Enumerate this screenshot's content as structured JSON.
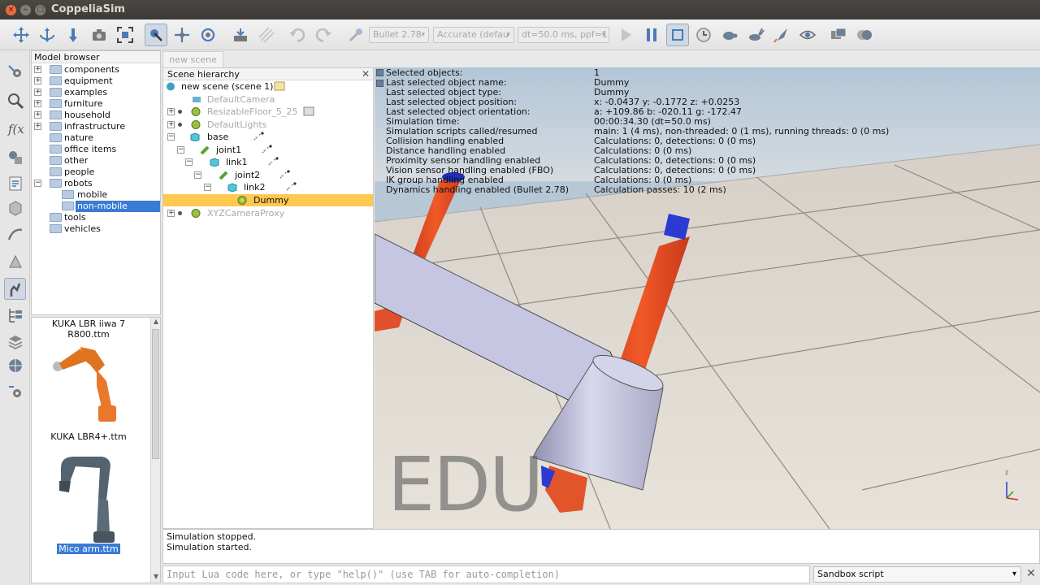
{
  "window": {
    "title": "CoppeliaSim",
    "close": "×",
    "minimize": "–",
    "maximize": "□"
  },
  "toolbar": {
    "physics_engine": "Bullet 2.78",
    "accuracy": "Accurate (defau",
    "time_step": "dt=50.0 ms, ppf=1"
  },
  "model_browser": {
    "title": "Model browser",
    "items": [
      {
        "label": "components",
        "expander": "+"
      },
      {
        "label": "equipment",
        "expander": "+"
      },
      {
        "label": "examples",
        "expander": "+"
      },
      {
        "label": "furniture",
        "expander": "+"
      },
      {
        "label": "household",
        "expander": "+"
      },
      {
        "label": "infrastructure",
        "expander": "+"
      },
      {
        "label": "nature",
        "expander": ""
      },
      {
        "label": "office items",
        "expander": ""
      },
      {
        "label": "other",
        "expander": ""
      },
      {
        "label": "people",
        "expander": ""
      },
      {
        "label": "robots",
        "expander": "−"
      },
      {
        "label": "mobile",
        "expander": ""
      },
      {
        "label": "non-mobile",
        "expander": ""
      },
      {
        "label": "tools",
        "expander": ""
      },
      {
        "label": "vehicles",
        "expander": ""
      }
    ]
  },
  "thumbnails": {
    "items": [
      {
        "caption": "KUKA LBR iiwa 7 R800.ttm"
      },
      {
        "caption": "KUKA LBR4+.ttm"
      },
      {
        "caption": "Mico arm.ttm"
      }
    ],
    "scroll_up": "▲",
    "scroll_down": "▼"
  },
  "scene_tab": {
    "label": "new scene"
  },
  "hierarchy": {
    "title": "Scene hierarchy",
    "close": "✕",
    "rows": [
      {
        "label": "new scene (scene 1)"
      },
      {
        "label": "DefaultCamera"
      },
      {
        "label": "ResizableFloor_5_25"
      },
      {
        "label": "DefaultLights"
      },
      {
        "label": "base"
      },
      {
        "label": "joint1"
      },
      {
        "label": "link1"
      },
      {
        "label": "joint2"
      },
      {
        "label": "link2"
      },
      {
        "label": "Dummy"
      },
      {
        "label": "XYZCameraProxy"
      }
    ]
  },
  "info_overlay": {
    "rows": [
      {
        "label": "Selected objects:",
        "value": "1"
      },
      {
        "label": "Last selected object name:",
        "value": "Dummy"
      },
      {
        "label": "Last selected object type:",
        "value": "Dummy"
      },
      {
        "label": "Last selected object position:",
        "value": "x: -0.0437    y: -0.1772    z: +0.0253"
      },
      {
        "label": "Last selected object orientation:",
        "value": "a: +109.86    b: -020.11    g: -172.47"
      },
      {
        "label": "Simulation time:",
        "value": "00:00:34.30 (dt=50.0 ms)"
      },
      {
        "label": "Simulation scripts called/resumed",
        "value": "main: 1 (4 ms), non-threaded: 0 (1 ms), running threads: 0 (0 ms)"
      },
      {
        "label": "Collision handling enabled",
        "value": "Calculations: 0, detections: 0 (0 ms)"
      },
      {
        "label": "Distance handling enabled",
        "value": "Calculations: 0 (0 ms)"
      },
      {
        "label": "Proximity sensor handling enabled",
        "value": "Calculations: 0, detections: 0 (0 ms)"
      },
      {
        "label": "Vision sensor handling enabled (FBO)",
        "value": "Calculations: 0, detections: 0 (0 ms)"
      },
      {
        "label": "IK group handling enabled",
        "value": "Calculations: 0 (0 ms)"
      },
      {
        "label": "Dynamics handling enabled (Bullet 2.78)",
        "value": "Calculation passes: 10 (2 ms)"
      }
    ],
    "watermark": "EDU",
    "axis_label": "z"
  },
  "status": {
    "lines": [
      "Simulation stopped.",
      "Simulation started."
    ]
  },
  "console": {
    "placeholder": "Input Lua code here, or type \"help()\" (use TAB for auto-completion)",
    "script_select": "Sandbox script",
    "clear": "✕"
  }
}
